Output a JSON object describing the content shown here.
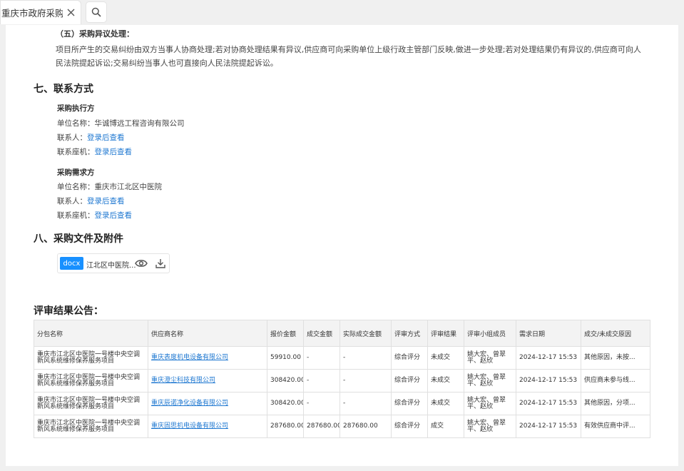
{
  "tab": {
    "title": "重庆市政府采购"
  },
  "colors": {
    "link": "#1f78d1",
    "docx_badge": "#1890ff"
  },
  "section_5": {
    "heading": "（五）采购异议处理：",
    "line1": "项目所产生的交易纠纷由双方当事人协商处理;若对协商处理结果有异议,供应商可向采购单位上级行政主管部门反映,做进一步处理;若对处理结果仍有异议的,供应商可向人",
    "line2": "民法院提起诉讼;交易纠纷当事人也可直接向人民法院提起诉讼。"
  },
  "section_7": {
    "heading": "七、联系方式",
    "executor": {
      "title": "采购执行方",
      "unit_label": "单位名称：",
      "unit_value": "华诚博远工程咨询有限公司",
      "contact_label": "联系人：",
      "contact_value": "登录后查看",
      "phone_label": "联系座机：",
      "phone_value": "登录后查看"
    },
    "demander": {
      "title": "采购需求方",
      "unit_label": "单位名称：",
      "unit_value": "重庆市江北区中医院",
      "contact_label": "联系人：",
      "contact_value": "登录后查看",
      "phone_label": "联系座机：",
      "phone_value": "登录后查看"
    }
  },
  "section_8": {
    "heading": "八、采购文件及附件",
    "attachment": {
      "badge": "docx",
      "name": "江北区中医院..."
    }
  },
  "result": {
    "heading": "评审结果公告：",
    "columns": [
      "分包名称",
      "供应商名称",
      "报价金额",
      "成交金额",
      "实际成交金额",
      "评审方式",
      "评审结果",
      "评审小组成员",
      "需求日期",
      "成交/未成交原因"
    ],
    "rows": [
      {
        "package": "重庆市江北区中医院一号楼中央空调新风系统维修保养服务项目",
        "supplier": "重庆表度机电设备有限公司",
        "bid": "59910.00",
        "deal": "-",
        "actual": "-",
        "method": "综合评分",
        "result": "未成交",
        "members": "姚大宏、曾翠平、赵欣",
        "date": "2024-12-17 15:53",
        "reason": "其他原因，未按..."
      },
      {
        "package": "重庆市江北区中医院一号楼中央空调新风系统维修保养服务项目",
        "supplier": "重庆澄尘科技有限公司",
        "bid": "308420.00",
        "deal": "-",
        "actual": "-",
        "method": "综合评分",
        "result": "未成交",
        "members": "姚大宏、曾翠平、赵欣",
        "date": "2024-12-17 15:53",
        "reason": "供应商未参与线..."
      },
      {
        "package": "重庆市江北区中医院一号楼中央空调新风系统维修保养服务项目",
        "supplier": "重庆辰诺净化设备有限公司",
        "bid": "308420.00",
        "deal": "-",
        "actual": "-",
        "method": "综合评分",
        "result": "未成交",
        "members": "姚大宏、曾翠平、赵欣",
        "date": "2024-12-17 15:53",
        "reason": "其他原因，分项..."
      },
      {
        "package": "重庆市江北区中医院一号楼中央空调新风系统维修保养服务项目",
        "supplier": "重庆固思机电设备有限公司",
        "bid": "287680.00",
        "deal": "287680.00",
        "actual": "287680.00",
        "method": "综合评分",
        "result": "成交",
        "members": "姚大宏、曾翠平、赵欣",
        "date": "2024-12-17 15:53",
        "reason": "有效供应商中评..."
      }
    ]
  }
}
